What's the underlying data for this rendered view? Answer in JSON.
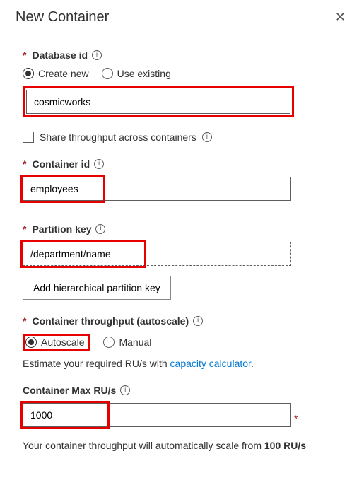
{
  "header": {
    "title": "New Container"
  },
  "database": {
    "label": "Database id",
    "create_new": "Create new",
    "use_existing": "Use existing",
    "value": "cosmicworks",
    "share_label": "Share throughput across containers"
  },
  "container": {
    "label": "Container id",
    "value": "employees"
  },
  "partition": {
    "label": "Partition key",
    "value": "/department/name",
    "add_hierarchical": "Add hierarchical partition key"
  },
  "throughput": {
    "label": "Container throughput (autoscale)",
    "autoscale": "Autoscale",
    "manual": "Manual",
    "estimate_prefix": "Estimate your required RU/s with ",
    "calculator": "capacity calculator",
    "max_label": "Container Max RU/s",
    "max_value": "1000",
    "note_prefix": "Your container throughput will automatically scale from ",
    "note_bold": "100 RU/s"
  }
}
